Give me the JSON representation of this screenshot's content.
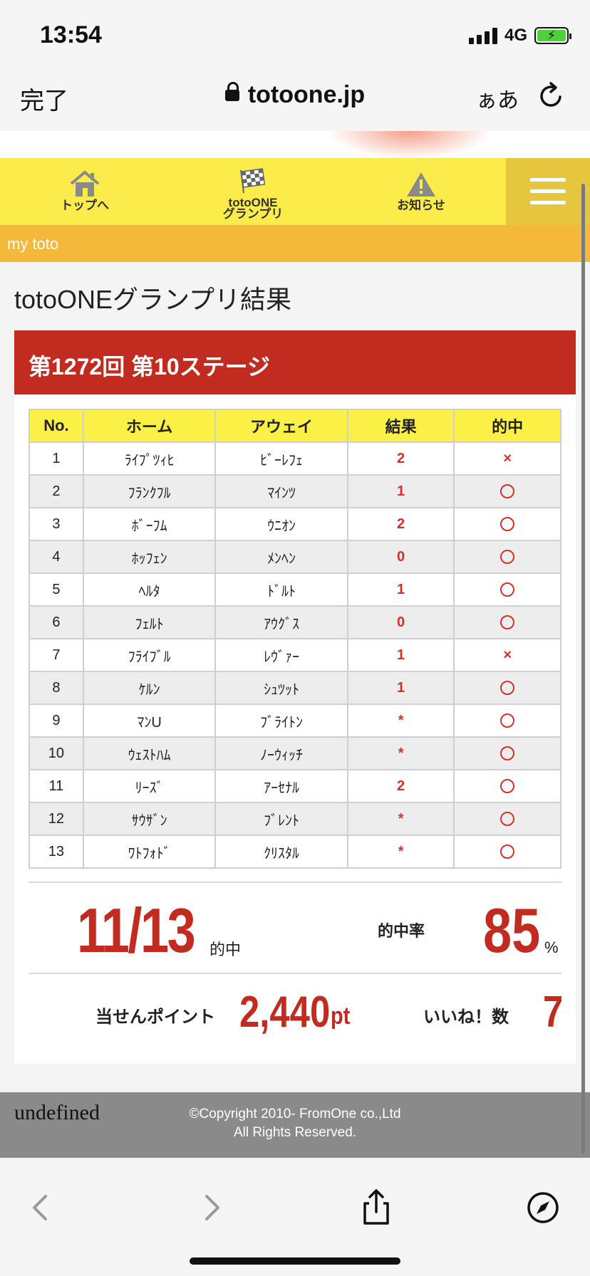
{
  "status_bar": {
    "time": "13:54",
    "network": "4G"
  },
  "browser": {
    "done_label": "完了",
    "url": "totoone.jp",
    "text_size_label": "ぁあ"
  },
  "nav": {
    "items": [
      {
        "label": "トップへ",
        "icon": "house-icon"
      },
      {
        "label_line1": "totoONE",
        "label_line2": "グランプリ",
        "icon": "checkered-flag-icon"
      },
      {
        "label": "お知らせ",
        "icon": "warning-icon"
      }
    ],
    "menu_icon": "hamburger-menu-icon"
  },
  "breadcrumb": "my toto",
  "page_title": "totoONEグランプリ結果",
  "stage_title": "第1272回 第10ステージ",
  "table": {
    "headers": [
      "No.",
      "ホーム",
      "アウェイ",
      "結果",
      "的中"
    ],
    "rows": [
      {
        "no": "1",
        "home": "ﾗｲﾌﾟﾂｨﾋ",
        "away": "ﾋﾞｰﾚﾌｪ",
        "result": "2",
        "hit": "×"
      },
      {
        "no": "2",
        "home": "ﾌﾗﾝｸﾌﾙ",
        "away": "ﾏｲﾝﾂ",
        "result": "1",
        "hit": "○"
      },
      {
        "no": "3",
        "home": "ﾎﾞｰﾌﾑ",
        "away": "ｳﾆｵﾝ",
        "result": "2",
        "hit": "○"
      },
      {
        "no": "4",
        "home": "ﾎｯﾌｪﾝ",
        "away": "ﾒﾝﾍﾝ",
        "result": "0",
        "hit": "○"
      },
      {
        "no": "5",
        "home": "ﾍﾙﾀ",
        "away": "ﾄﾞﾙﾄ",
        "result": "1",
        "hit": "○"
      },
      {
        "no": "6",
        "home": "ﾌｪﾙﾄ",
        "away": "ｱｳｸﾞｽ",
        "result": "0",
        "hit": "○"
      },
      {
        "no": "7",
        "home": "ﾌﾗｲﾌﾞﾙ",
        "away": "ﾚｳﾞｧｰ",
        "result": "1",
        "hit": "×"
      },
      {
        "no": "8",
        "home": "ｹﾙﾝ",
        "away": "ｼｭﾂｯﾄ",
        "result": "1",
        "hit": "○"
      },
      {
        "no": "9",
        "home": "ﾏﾝU",
        "away": "ﾌﾞﾗｲﾄﾝ",
        "result": "*",
        "hit": "○"
      },
      {
        "no": "10",
        "home": "ｳｪｽﾄﾊﾑ",
        "away": "ﾉｰｳｨｯﾁ",
        "result": "*",
        "hit": "○"
      },
      {
        "no": "11",
        "home": "ﾘｰｽﾞ",
        "away": "ｱｰｾﾅﾙ",
        "result": "2",
        "hit": "○"
      },
      {
        "no": "12",
        "home": "ｻｳｻﾞﾝ",
        "away": "ﾌﾞﾚﾝﾄ",
        "result": "*",
        "hit": "○"
      },
      {
        "no": "13",
        "home": "ﾜﾄﾌｫﾄﾞ",
        "away": "ｸﾘｽﾀﾙ",
        "result": "*",
        "hit": "○"
      }
    ]
  },
  "summary": {
    "hits": "11/13",
    "hits_suffix": "的中",
    "rate_label": "的中率",
    "rate": "85",
    "rate_unit": "%",
    "points_label": "当せんポイント",
    "points": "2,440",
    "points_unit": "pt",
    "likes_label": "いいね！数",
    "likes": "7"
  },
  "footer": {
    "stray_text": "undefined",
    "copyright_line1": "©Copyright 2010- FromOne co.,Ltd",
    "copyright_line2": "All Rights Reserved."
  },
  "colors": {
    "accent_red": "#c12b20",
    "nav_yellow": "#fbec4c",
    "breadcrumb_orange": "#f4b93b",
    "header_yellow": "#fbf045"
  }
}
